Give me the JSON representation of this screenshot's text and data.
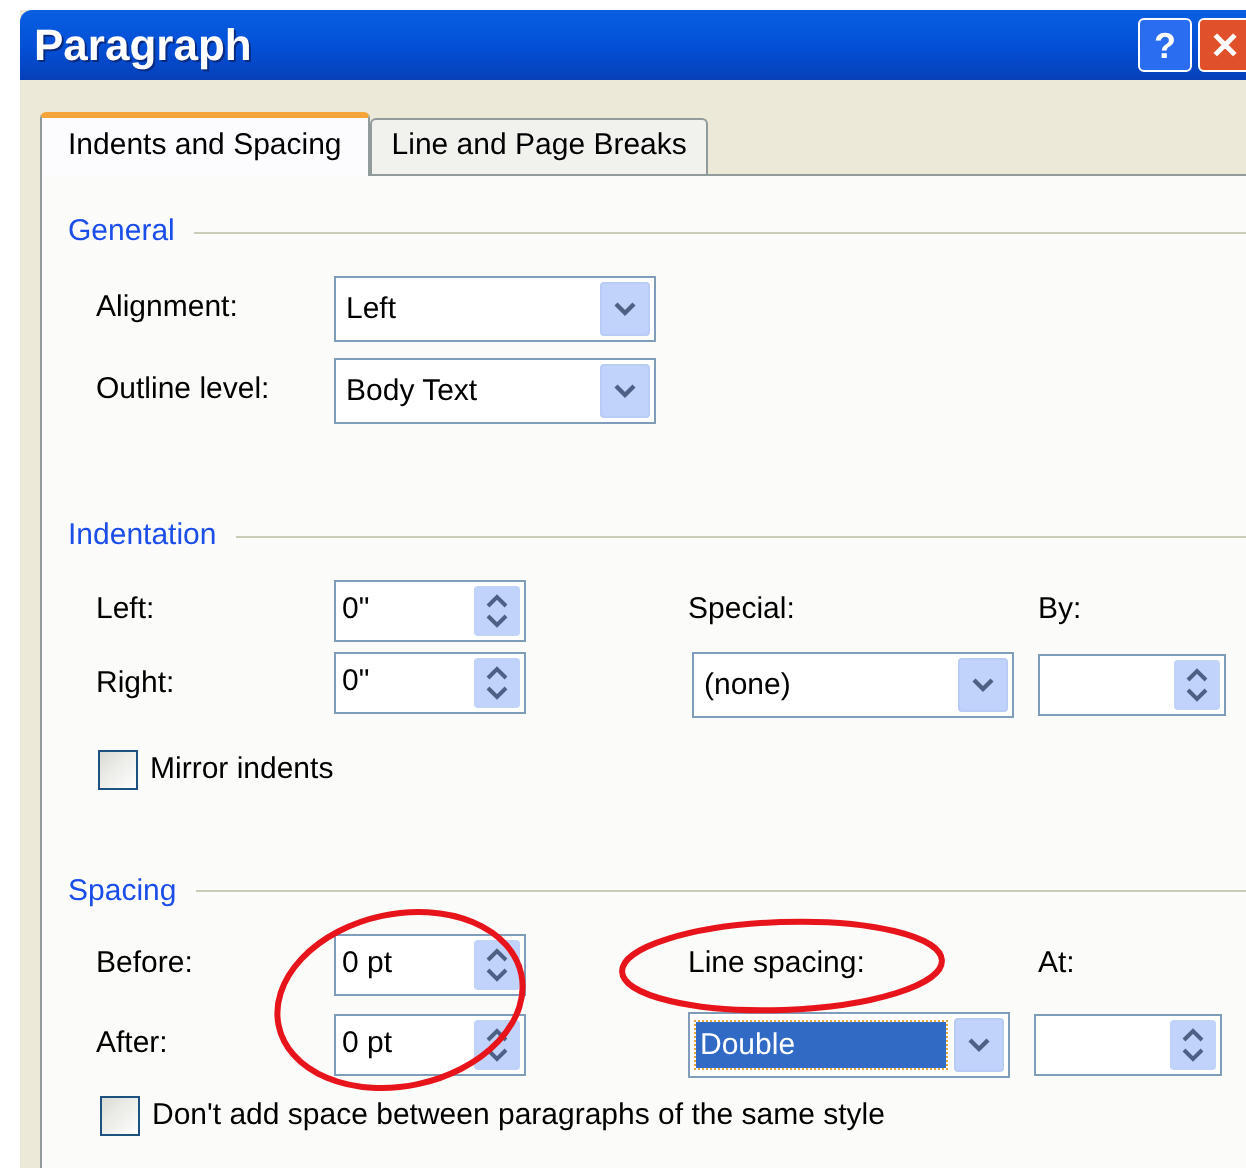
{
  "window": {
    "title": "Paragraph",
    "buttons": [
      {
        "kind": "help",
        "label": "?"
      },
      {
        "kind": "close",
        "label": "✕"
      }
    ]
  },
  "tabs": [
    {
      "label": "Indents and Spacing",
      "selected": true
    },
    {
      "label": "Line and Page Breaks",
      "selected": false
    }
  ],
  "general": {
    "heading": "General",
    "alignment": {
      "label": "Alignment:",
      "value": "Left"
    },
    "outline_level": {
      "label": "Outline level:",
      "value": "Body Text"
    }
  },
  "indentation": {
    "heading": "Indentation",
    "left": {
      "label": "Left:",
      "value": "0\""
    },
    "right": {
      "label": "Right:",
      "value": "0\""
    },
    "special": {
      "label": "Special:",
      "value": "(none)"
    },
    "by": {
      "label": "By:"
    },
    "mirror_indents": {
      "label": "Mirror indents",
      "checked": false
    }
  },
  "spacing": {
    "heading": "Spacing",
    "before": {
      "label": "Before:",
      "value": "0 pt"
    },
    "after": {
      "label": "After:",
      "value": "0 pt"
    },
    "before_after_circled": true,
    "line_spacing": {
      "label": "Line spacing:",
      "circled": true,
      "value": "Double",
      "selected": true
    },
    "at": {
      "label": "At:"
    },
    "dont_add_space": {
      "label": "Don't add space between paragraphs of the same style",
      "checked": false
    }
  }
}
